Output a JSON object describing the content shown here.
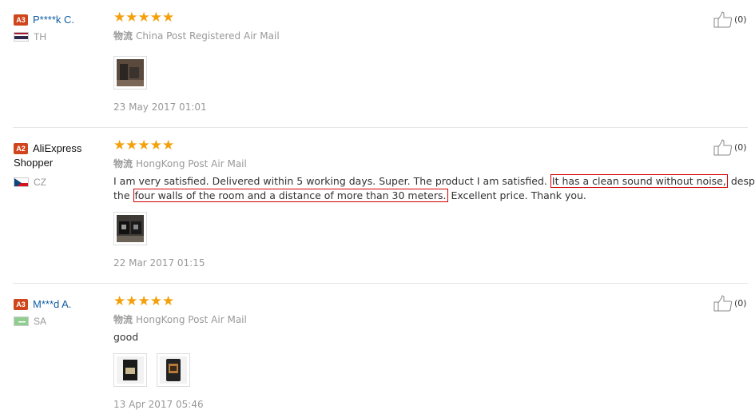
{
  "reviews": [
    {
      "badge": "A3",
      "name": "P****k C.",
      "country": "TH",
      "rating": "★★★★★",
      "logistics_label": "物流",
      "logistics": "China Post Registered Air Mail",
      "text": "",
      "date": "23 May 2017 01:01",
      "likes": "(0)",
      "photo_count": 1
    },
    {
      "badge": "A2",
      "name": "AliExpress",
      "name_line2": "Shopper",
      "country": "CZ",
      "rating": "★★★★★",
      "logistics_label": "物流",
      "logistics": "HongKong Post Air Mail",
      "text_line1_a": "I am very satisfied. Delivered within 5 working days. Super. The product I am satisfied.",
      "text_line1_hl": "It has a clean sound without noise,",
      "text_line1_b": "despite",
      "text_line2_a": "the",
      "text_line2_hl": "four walls of the room and a distance of more than 30 meters.",
      "text_line2_b": "Excellent price. Thank you.",
      "date": "22 Mar 2017 01:15",
      "likes": "(0)",
      "photo_count": 1
    },
    {
      "badge": "A3",
      "name": "M***d A.",
      "country": "SA",
      "rating": "★★★★★",
      "logistics_label": "物流",
      "logistics": "HongKong Post Air Mail",
      "text": "good",
      "date": "13 Apr 2017 05:46",
      "likes": "(0)",
      "photo_count": 2
    }
  ],
  "colors": {
    "badge": "#d0451b",
    "star": "#f3a00b",
    "name_link": "#0e5da3",
    "highlight_border": "#d40000"
  },
  "icons": {
    "like": "thumbs-up-icon"
  }
}
